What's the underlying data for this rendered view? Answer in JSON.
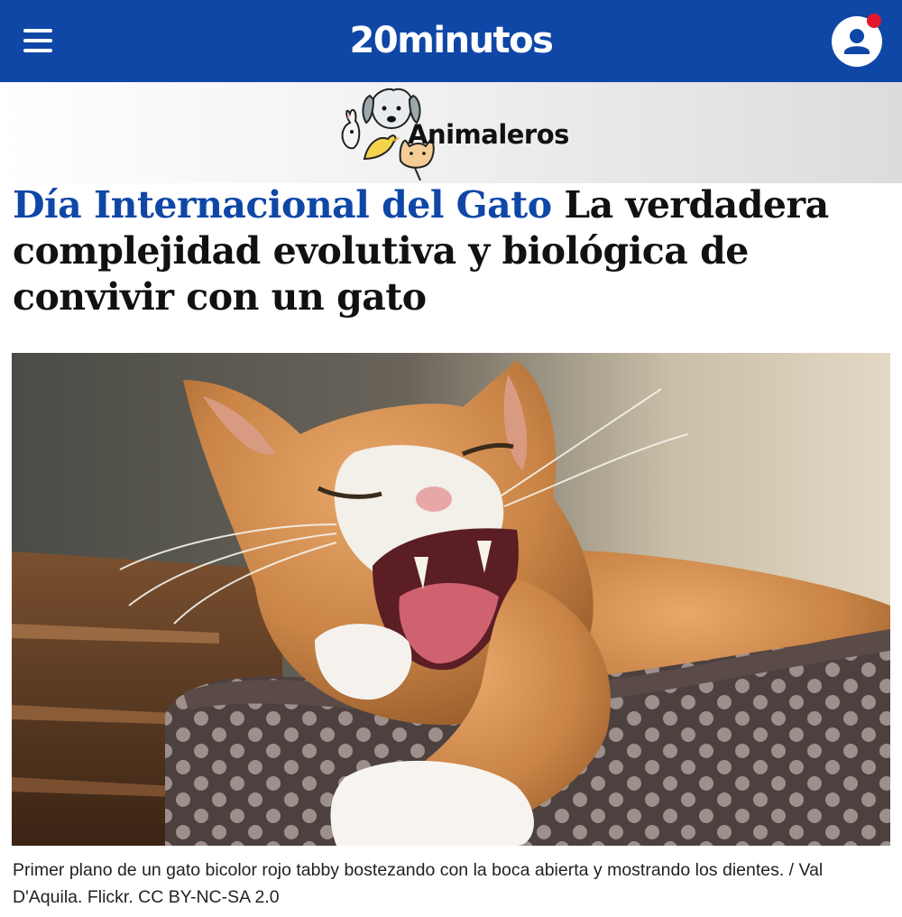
{
  "header": {
    "site_name": "20minutos",
    "menu_icon": "hamburger-icon",
    "user_icon": "user-icon",
    "notification": true,
    "brand_color": "#0f47a6",
    "notification_color": "#e3172b"
  },
  "section": {
    "logo_text": "Animaleros",
    "logo_icon": "animals-illustration-icon"
  },
  "article": {
    "kicker": "Día Internacional del Gato",
    "title": "La verdadera complejidad evolutiva y biológica de convivir con un gato",
    "kicker_color": "#0f47a6"
  },
  "hero": {
    "caption": "Primer plano de un gato bicolor rojo tabby bostezando con la boca abierta y mostrando los dientes. / Val D'Aquila. Flickr. CC BY-NC-SA 2.0"
  }
}
